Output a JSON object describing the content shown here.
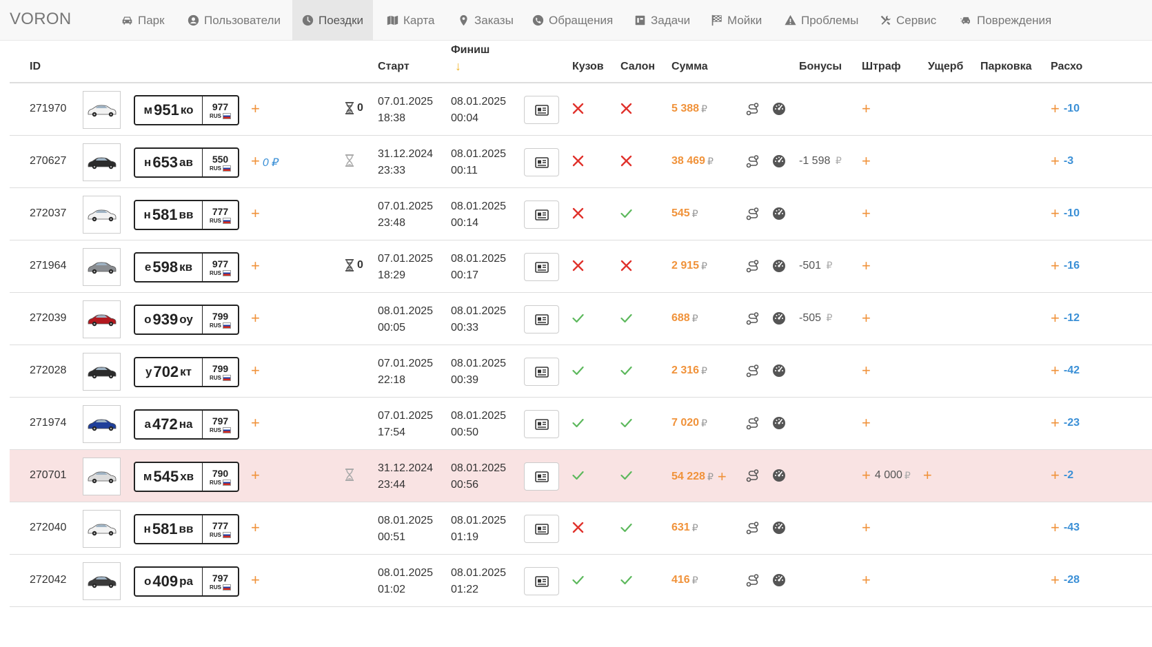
{
  "navbar": {
    "brand": "VORON",
    "items": [
      {
        "key": "park",
        "label": "Парк",
        "icon": "car-icon",
        "active": false
      },
      {
        "key": "users",
        "label": "Пользователи",
        "icon": "user-circle-icon",
        "active": false
      },
      {
        "key": "trips",
        "label": "Поездки",
        "icon": "clock-icon",
        "active": true
      },
      {
        "key": "map",
        "label": "Карта",
        "icon": "map-icon",
        "active": false
      },
      {
        "key": "orders",
        "label": "Заказы",
        "icon": "map-marker-icon",
        "active": false
      },
      {
        "key": "appeals",
        "label": "Обращения",
        "icon": "phone-icon",
        "active": false
      },
      {
        "key": "tasks",
        "label": "Задачи",
        "icon": "tasks-icon",
        "active": false
      },
      {
        "key": "washes",
        "label": "Мойки",
        "icon": "flag-checkered-icon",
        "active": false
      },
      {
        "key": "problems",
        "label": "Проблемы",
        "icon": "warning-icon",
        "active": false
      },
      {
        "key": "service",
        "label": "Сервис",
        "icon": "tools-icon",
        "active": false
      },
      {
        "key": "damages",
        "label": "Повреждения",
        "icon": "car-crash-icon",
        "active": false
      }
    ]
  },
  "table": {
    "headers": {
      "id": "ID",
      "start": "Старт",
      "finish": "Финиш",
      "finish_sort": "↓",
      "body": "Кузов",
      "salon": "Салон",
      "sum": "Сумма",
      "bonuses": "Бонусы",
      "fine": "Штраф",
      "damage": "Ущерб",
      "parking": "Парковка",
      "expenses": "Расхо"
    },
    "currency": "₽",
    "rows": [
      {
        "id": "271970",
        "car_color": "#f2f2f2",
        "plate": {
          "l1": "м",
          "num": "951",
          "l2": "ко",
          "region": "977",
          "rus": "RUS"
        },
        "plus_value": "",
        "hourglass": true,
        "hourglass_count": "0",
        "start_date": "07.01.2025",
        "start_time": "18:38",
        "finish_date": "08.01.2025",
        "finish_time": "00:04",
        "body_ok": false,
        "salon_ok": false,
        "sum": "5 388",
        "sum_plus": false,
        "bonus": "",
        "fine": "",
        "fine_plus2": false,
        "expense": "-10",
        "highlight": false
      },
      {
        "id": "270627",
        "car_color": "#2b2b2b",
        "plate": {
          "l1": "н",
          "num": "653",
          "l2": "ав",
          "region": "550",
          "rus": "RUS"
        },
        "plus_value": "0 ₽",
        "hourglass": true,
        "hourglass_count": "",
        "start_date": "31.12.2024",
        "start_time": "23:33",
        "finish_date": "08.01.2025",
        "finish_time": "00:11",
        "body_ok": false,
        "salon_ok": false,
        "sum": "38 469",
        "sum_plus": false,
        "bonus": "-1 598",
        "fine": "",
        "fine_plus2": false,
        "expense": "-3",
        "highlight": false
      },
      {
        "id": "272037",
        "car_color": "#f2f2f2",
        "plate": {
          "l1": "н",
          "num": "581",
          "l2": "вв",
          "region": "777",
          "rus": "RUS"
        },
        "plus_value": "",
        "hourglass": false,
        "hourglass_count": "",
        "start_date": "07.01.2025",
        "start_time": "23:48",
        "finish_date": "08.01.2025",
        "finish_time": "00:14",
        "body_ok": false,
        "salon_ok": true,
        "sum": "545",
        "sum_plus": false,
        "bonus": "",
        "fine": "",
        "fine_plus2": false,
        "expense": "-10",
        "highlight": false
      },
      {
        "id": "271964",
        "car_color": "#8a8d91",
        "plate": {
          "l1": "е",
          "num": "598",
          "l2": "кв",
          "region": "977",
          "rus": "RUS"
        },
        "plus_value": "",
        "hourglass": true,
        "hourglass_count": "0",
        "start_date": "07.01.2025",
        "start_time": "18:29",
        "finish_date": "08.01.2025",
        "finish_time": "00:17",
        "body_ok": false,
        "salon_ok": false,
        "sum": "2 915",
        "sum_plus": false,
        "bonus": "-501",
        "fine": "",
        "fine_plus2": false,
        "expense": "-16",
        "highlight": false
      },
      {
        "id": "272039",
        "car_color": "#b3191f",
        "plate": {
          "l1": "о",
          "num": "939",
          "l2": "оу",
          "region": "799",
          "rus": "RUS"
        },
        "plus_value": "",
        "hourglass": false,
        "hourglass_count": "",
        "start_date": "08.01.2025",
        "start_time": "00:05",
        "finish_date": "08.01.2025",
        "finish_time": "00:33",
        "body_ok": true,
        "salon_ok": true,
        "sum": "688",
        "sum_plus": false,
        "bonus": "-505",
        "fine": "",
        "fine_plus2": false,
        "expense": "-12",
        "highlight": false
      },
      {
        "id": "272028",
        "car_color": "#2b2b2b",
        "plate": {
          "l1": "у",
          "num": "702",
          "l2": "кт",
          "region": "799",
          "rus": "RUS"
        },
        "plus_value": "",
        "hourglass": false,
        "hourglass_count": "",
        "start_date": "07.01.2025",
        "start_time": "22:18",
        "finish_date": "08.01.2025",
        "finish_time": "00:39",
        "body_ok": true,
        "salon_ok": true,
        "sum": "2 316",
        "sum_plus": false,
        "bonus": "",
        "fine": "",
        "fine_plus2": false,
        "expense": "-42",
        "highlight": false
      },
      {
        "id": "271974",
        "car_color": "#1f3f9a",
        "plate": {
          "l1": "а",
          "num": "472",
          "l2": "на",
          "region": "797",
          "rus": "RUS"
        },
        "plus_value": "",
        "hourglass": false,
        "hourglass_count": "",
        "start_date": "07.01.2025",
        "start_time": "17:54",
        "finish_date": "08.01.2025",
        "finish_time": "00:50",
        "body_ok": true,
        "salon_ok": true,
        "sum": "7 020",
        "sum_plus": false,
        "bonus": "",
        "fine": "",
        "fine_plus2": false,
        "expense": "-23",
        "highlight": false
      },
      {
        "id": "270701",
        "car_color": "#dcdcdc",
        "plate": {
          "l1": "м",
          "num": "545",
          "l2": "хв",
          "region": "790",
          "rus": "RUS"
        },
        "plus_value": "",
        "hourglass": true,
        "hourglass_count": "",
        "start_date": "31.12.2024",
        "start_time": "23:44",
        "finish_date": "08.01.2025",
        "finish_time": "00:56",
        "body_ok": true,
        "salon_ok": true,
        "sum": "54 228",
        "sum_plus": true,
        "bonus": "",
        "fine": "4 000",
        "fine_plus2": true,
        "expense": "-2",
        "highlight": true
      },
      {
        "id": "272040",
        "car_color": "#f2f2f2",
        "plate": {
          "l1": "н",
          "num": "581",
          "l2": "вв",
          "region": "777",
          "rus": "RUS"
        },
        "plus_value": "",
        "hourglass": false,
        "hourglass_count": "",
        "start_date": "08.01.2025",
        "start_time": "00:51",
        "finish_date": "08.01.2025",
        "finish_time": "01:19",
        "body_ok": false,
        "salon_ok": true,
        "sum": "631",
        "sum_plus": false,
        "bonus": "",
        "fine": "",
        "fine_plus2": false,
        "expense": "-43",
        "highlight": false
      },
      {
        "id": "272042",
        "car_color": "#3a3a3a",
        "plate": {
          "l1": "о",
          "num": "409",
          "l2": "ра",
          "region": "797",
          "rus": "RUS"
        },
        "plus_value": "",
        "hourglass": false,
        "hourglass_count": "",
        "start_date": "08.01.2025",
        "start_time": "01:02",
        "finish_date": "08.01.2025",
        "finish_time": "01:22",
        "body_ok": true,
        "salon_ok": true,
        "sum": "416",
        "sum_plus": false,
        "bonus": "",
        "fine": "",
        "fine_plus2": false,
        "expense": "-28",
        "highlight": false
      }
    ]
  }
}
